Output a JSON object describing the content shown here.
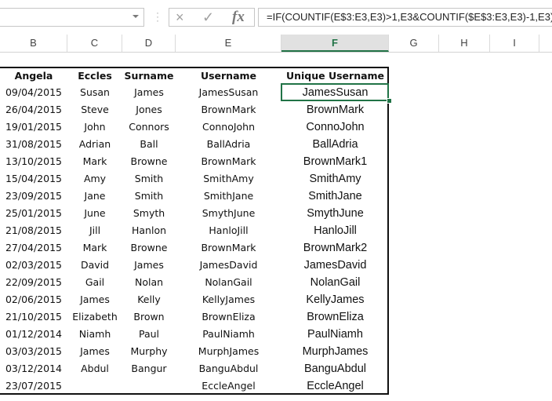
{
  "formula_bar": {
    "name_box": "",
    "cancel_icon": "×",
    "enter_icon": "✓",
    "fx_label": "fx",
    "formula": "=IF(COUNTIF(E$3:E3,E3)>1,E3&COUNTIF($E$3:E3,E3)-1,E3)"
  },
  "columns": [
    "B",
    "C",
    "D",
    "E",
    "F",
    "G",
    "H",
    "I"
  ],
  "active_column": "F",
  "accent_color": "#217346",
  "table": {
    "headers": [
      "Angela",
      "Eccles",
      "Surname",
      "Username",
      "Unique Username"
    ],
    "rows": [
      [
        "09/04/2015",
        "Susan",
        "James",
        "JamesSusan",
        "JamesSusan"
      ],
      [
        "26/04/2015",
        "Steve",
        "Jones",
        "BrownMark",
        "BrownMark"
      ],
      [
        "19/01/2015",
        "John",
        "Connors",
        "ConnoJohn",
        "ConnoJohn"
      ],
      [
        "31/08/2015",
        "Adrian",
        "Ball",
        "BallAdria",
        "BallAdria"
      ],
      [
        "13/10/2015",
        "Mark",
        "Browne",
        "BrownMark",
        "BrownMark1"
      ],
      [
        "15/04/2015",
        "Amy",
        "Smith",
        "SmithAmy",
        "SmithAmy"
      ],
      [
        "23/09/2015",
        "Jane",
        "Smith",
        "SmithJane",
        "SmithJane"
      ],
      [
        "25/01/2015",
        "June",
        "Smyth",
        "SmythJune",
        "SmythJune"
      ],
      [
        "21/08/2015",
        "Jill",
        "Hanlon",
        "HanloJill",
        "HanloJill"
      ],
      [
        "27/04/2015",
        "Mark",
        "Browne",
        "BrownMark",
        "BrownMark2"
      ],
      [
        "02/03/2015",
        "David",
        "James",
        "JamesDavid",
        "JamesDavid"
      ],
      [
        "22/09/2015",
        "Gail",
        "Nolan",
        "NolanGail",
        "NolanGail"
      ],
      [
        "02/06/2015",
        "James",
        "Kelly",
        "KellyJames",
        "KellyJames"
      ],
      [
        "21/10/2015",
        "Elizabeth",
        "Brown",
        "BrownEliza",
        "BrownEliza"
      ],
      [
        "01/12/2014",
        "Niamh",
        "Paul",
        "PaulNiamh",
        "PaulNiamh"
      ],
      [
        "03/03/2015",
        "James",
        "Murphy",
        "MurphJames",
        "MurphJames"
      ],
      [
        "03/12/2014",
        "Abdul",
        "Bangur",
        "BanguAbdul",
        "BanguAbdul"
      ],
      [
        "23/07/2015",
        "",
        "",
        "EccleAngel",
        "EccleAngel"
      ]
    ]
  }
}
